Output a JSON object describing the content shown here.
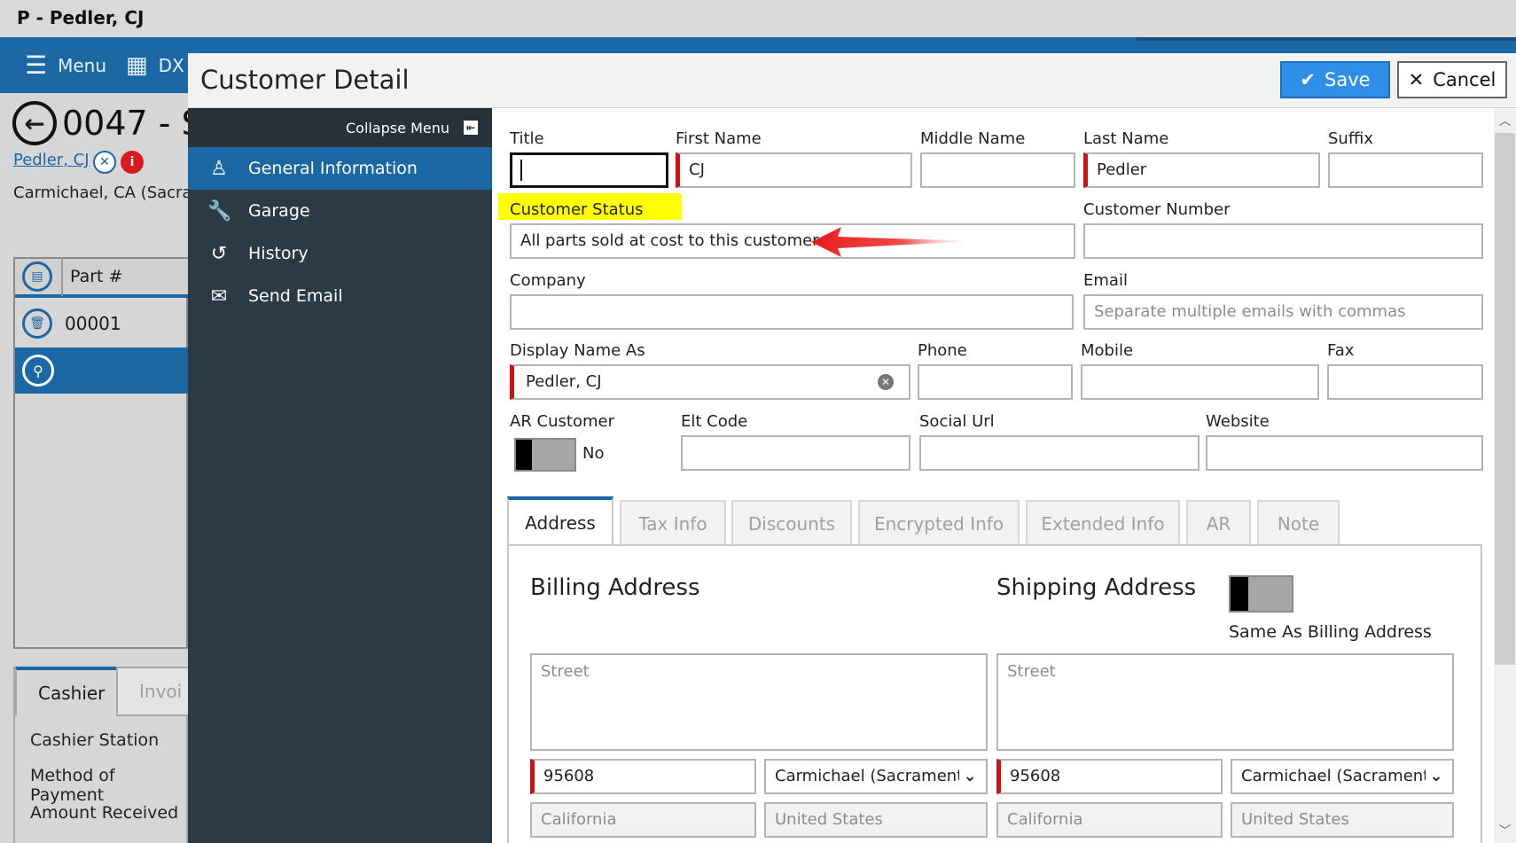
{
  "window": {
    "title": "P - Pedler, CJ"
  },
  "topnav": {
    "menu_label": "Menu",
    "dx_label": "DX"
  },
  "order": {
    "number": "0047 - S",
    "customer_link": "Pedler, CJ",
    "location": "Carmichael, CA (Sacran"
  },
  "grid": {
    "column_part": "Part #",
    "row1_part": "00001"
  },
  "bottom": {
    "tab_cashier": "Cashier",
    "tab_invoice": "Invoi",
    "cashier_station": "Cashier Station",
    "method_of_payment": "Method of Payment",
    "amount_received": "Amount Received"
  },
  "modal": {
    "title": "Customer Detail",
    "save_label": "Save",
    "cancel_label": "Cancel"
  },
  "sidebar": {
    "collapse_label": "Collapse Menu",
    "items": [
      {
        "label": "General Information"
      },
      {
        "label": "Garage"
      },
      {
        "label": "History"
      },
      {
        "label": "Send Email"
      }
    ]
  },
  "form": {
    "title_label": "Title",
    "title_value": "",
    "first_name_label": "First Name",
    "first_name_value": "CJ",
    "middle_name_label": "Middle Name",
    "middle_name_value": "",
    "last_name_label": "Last Name",
    "last_name_value": "Pedler",
    "suffix_label": "Suffix",
    "suffix_value": "",
    "customer_status_label": "Customer Status",
    "customer_status_value": "All parts sold at cost to this customer",
    "customer_number_label": "Customer Number",
    "customer_number_value": "",
    "company_label": "Company",
    "company_value": "",
    "email_label": "Email",
    "email_placeholder": "Separate multiple emails with commas",
    "display_name_label": "Display Name As",
    "display_name_value": "Pedler, CJ",
    "phone_label": "Phone",
    "mobile_label": "Mobile",
    "fax_label": "Fax",
    "ar_customer_label": "AR Customer",
    "ar_customer_value": "No",
    "elt_code_label": "Elt Code",
    "social_url_label": "Social Url",
    "website_label": "Website"
  },
  "tabs": [
    {
      "label": "Address"
    },
    {
      "label": "Tax Info"
    },
    {
      "label": "Discounts"
    },
    {
      "label": "Encrypted Info"
    },
    {
      "label": "Extended Info"
    },
    {
      "label": "AR"
    },
    {
      "label": "Note"
    }
  ],
  "address": {
    "billing_title": "Billing Address",
    "shipping_title": "Shipping Address",
    "same_as_billing_label": "Same As Billing Address",
    "street_placeholder": "Street",
    "billing_zip": "95608",
    "billing_city": "Carmichael (Sacramento)",
    "billing_state": "California",
    "billing_country": "United States",
    "shipping_zip": "95608",
    "shipping_city": "Carmichael (Sacramento)",
    "shipping_state": "California",
    "shipping_country": "United States"
  },
  "colors": {
    "accent": "#1c68a5",
    "sidebar": "#2c3a45",
    "required": "#d01111",
    "highlight": "#ffff00",
    "annotation_arrow": "#e81c1c"
  }
}
